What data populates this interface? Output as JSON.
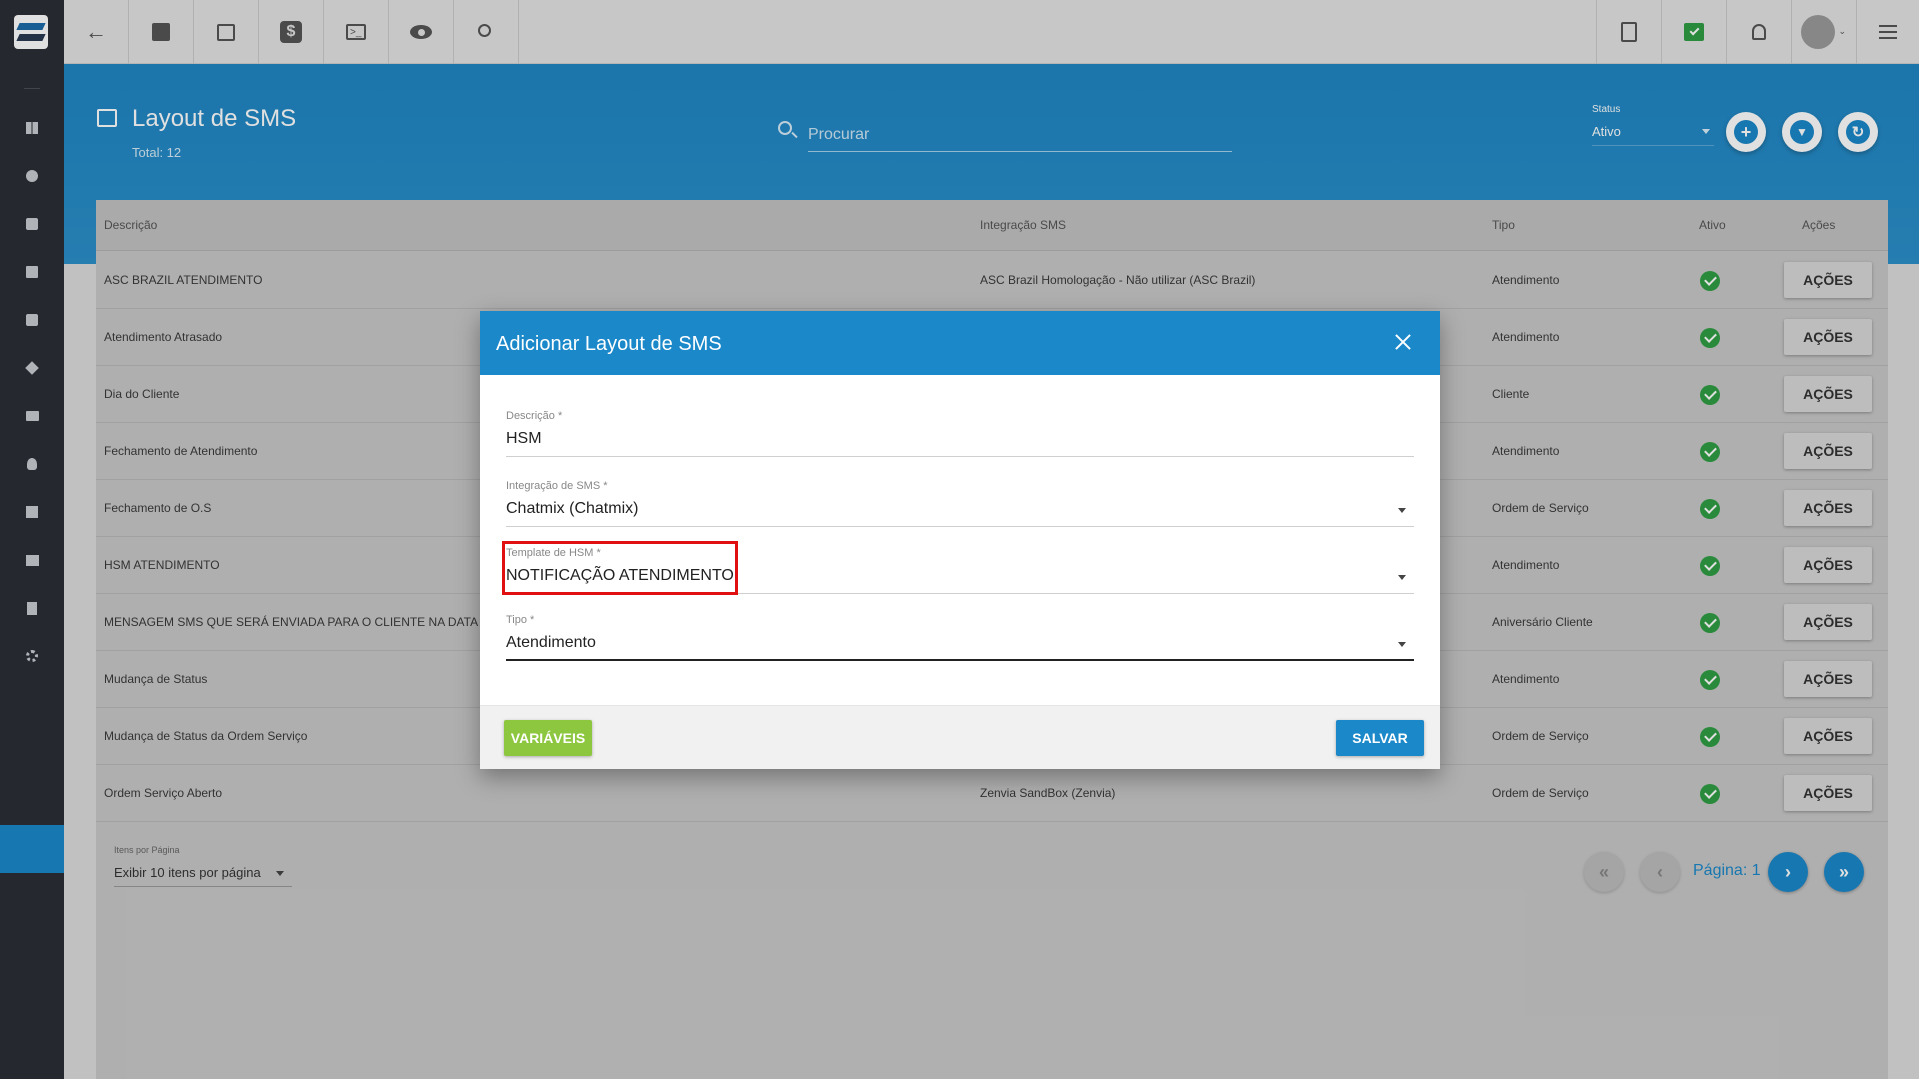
{
  "topbar": {
    "left_icons": [
      "back-arrow-icon",
      "contact-card-icon",
      "calendar-clock-icon",
      "dollar-icon",
      "terminal-icon",
      "eye-icon",
      "search-icon"
    ],
    "right_icons": [
      "pdf-file-icon",
      "chat-check-icon",
      "bell-icon",
      "avatar",
      "menu-list-icon"
    ],
    "chat_icon_color": "#2f9e44"
  },
  "sidebar": {
    "icons": [
      "dashboard-icon",
      "palette-icon",
      "contact-icon",
      "book-icon",
      "calendar-icon",
      "box-icon",
      "money-icon",
      "person-pin-icon",
      "list-icon",
      "storage-icon",
      "document-icon",
      "gear-icon"
    ],
    "active_color": "#1b88c9"
  },
  "header": {
    "title": "Layout de SMS",
    "total": "Total: 12",
    "search_placeholder": "Procurar",
    "status_label": "Status",
    "status_value": "Ativo",
    "buttons": [
      "add-icon",
      "filter-icon",
      "refresh-icon"
    ]
  },
  "table": {
    "columns": [
      "Descrição",
      "Integração SMS",
      "Tipo",
      "Ativo",
      "Ações"
    ],
    "action_label": "AÇÕES",
    "rows": [
      {
        "descricao": "ASC BRAZIL ATENDIMENTO",
        "integracao": "ASC Brazil Homologação - Não utilizar (ASC Brazil)",
        "tipo": "Atendimento",
        "ativo": true
      },
      {
        "descricao": "Atendimento Atrasado",
        "integracao": "",
        "tipo": "Atendimento",
        "ativo": true
      },
      {
        "descricao": "Dia do Cliente",
        "integracao": "",
        "tipo": "Cliente",
        "ativo": true
      },
      {
        "descricao": "Fechamento de Atendimento",
        "integracao": "",
        "tipo": "Atendimento",
        "ativo": true
      },
      {
        "descricao": "Fechamento de O.S",
        "integracao": "",
        "tipo": "Ordem de Serviço",
        "ativo": true
      },
      {
        "descricao": "HSM ATENDIMENTO",
        "integracao": "",
        "tipo": "Atendimento",
        "ativo": true
      },
      {
        "descricao": "MENSAGEM SMS QUE SERÁ ENVIADA PARA O CLIENTE NA DATA",
        "integracao": "",
        "tipo": "Aniversário Cliente",
        "ativo": true
      },
      {
        "descricao": "Mudança de Status",
        "integracao": "",
        "tipo": "Atendimento",
        "ativo": true
      },
      {
        "descricao": "Mudança de Status da Ordem Serviço",
        "integracao": "",
        "tipo": "Ordem de Serviço",
        "ativo": true
      },
      {
        "descricao": "Ordem Serviço Aberto",
        "integracao": "Zenvia SandBox (Zenvia)",
        "tipo": "Ordem de Serviço",
        "ativo": true
      }
    ]
  },
  "pagination": {
    "per_page_label": "Itens por Página",
    "per_page_value": "Exibir 10 itens por página",
    "page_label": "Página: 1",
    "first_icon": "«",
    "prev_icon": "‹",
    "next_icon": "›",
    "last_icon": "»"
  },
  "modal": {
    "title": "Adicionar Layout de SMS",
    "fields": [
      {
        "label": "Descrição *",
        "value": "HSM"
      },
      {
        "label": "Integração de SMS *",
        "value": "Chatmix (Chatmix)"
      },
      {
        "label": "Template de HSM *",
        "value": "NOTIFICAÇÃO ATENDIMENTO"
      },
      {
        "label": "Tipo *",
        "value": "Atendimento"
      }
    ],
    "variables_button": "VARIÁVEIS",
    "save_button": "SALVAR",
    "highlight_color": "#e01010"
  },
  "colors": {
    "accent": "#1b88c9",
    "success": "#2f9e44",
    "variables": "#8dc63f"
  }
}
